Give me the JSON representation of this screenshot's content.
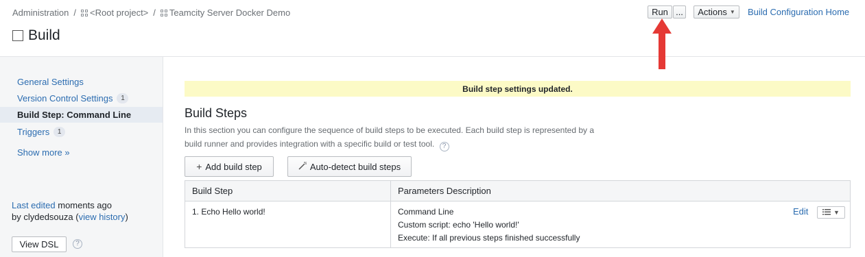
{
  "breadcrumb": {
    "items": [
      "Administration",
      "<Root project>",
      "Teamcity Server Docker Demo"
    ],
    "separator": "/"
  },
  "page": {
    "title": "Build"
  },
  "header": {
    "run_label": "Run",
    "more_label": "...",
    "actions_label": "Actions",
    "home_link": "Build Configuration Home"
  },
  "sidebar": {
    "items": [
      {
        "label": "General Settings",
        "badge": ""
      },
      {
        "label": "Version Control Settings",
        "badge": "1"
      },
      {
        "label": "Build Step: Command Line",
        "badge": ""
      },
      {
        "label": "Triggers",
        "badge": "1"
      }
    ],
    "show_more": "Show more »",
    "last_edited_label": "Last edited",
    "last_edited_time": "moments ago",
    "edited_by": "by clydedsouza",
    "view_history": "view history",
    "view_dsl": "View DSL"
  },
  "banner": {
    "text": "Build step settings updated."
  },
  "build_steps": {
    "title": "Build Steps",
    "description": "In this section you can configure the sequence of build steps to be executed. Each build step is represented by a build runner and provides integration with a specific build or test tool.",
    "add_label": "Add build step",
    "auto_label": "Auto-detect build steps",
    "columns": [
      "Build Step",
      "Parameters Description"
    ],
    "rows": [
      {
        "step": "1. Echo Hello world!",
        "params": [
          "Command Line",
          "Custom script: echo 'Hello world!'",
          "Execute: If all previous steps finished successfully"
        ],
        "edit_label": "Edit"
      }
    ]
  },
  "colors": {
    "link": "#2b6cb0",
    "banner": "#fcfac6",
    "arrow": "#e53935",
    "sidebar_bg": "#f5f6f7"
  }
}
